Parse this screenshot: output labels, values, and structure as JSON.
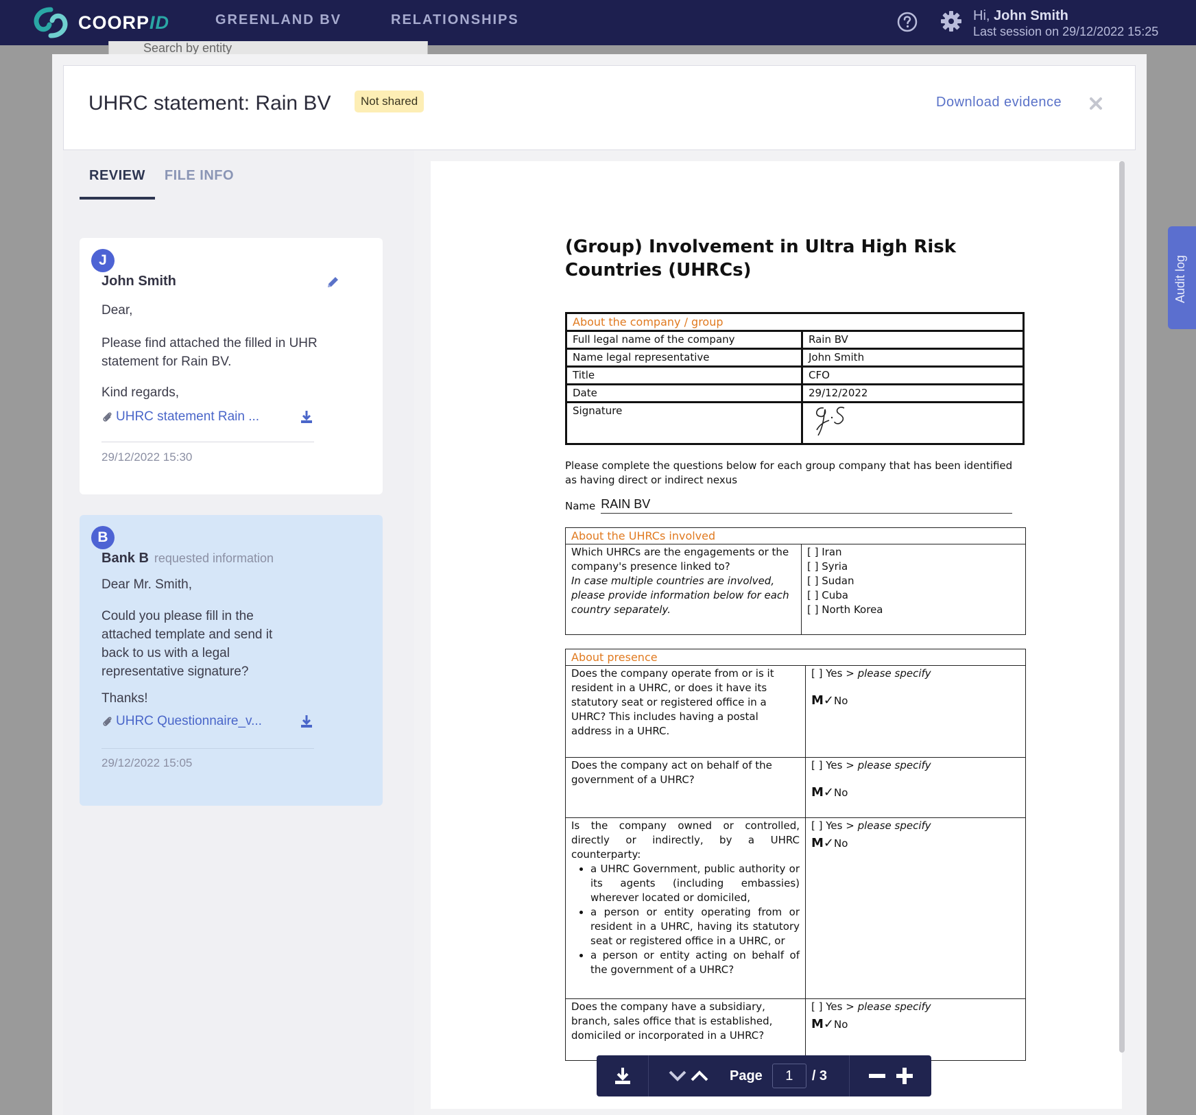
{
  "topbar": {
    "logo_text": "COORP",
    "logo_suffix": "ID",
    "nav": [
      "GREENLAND BV",
      "RELATIONSHIPS"
    ],
    "greeting_prefix": "Hi,",
    "user_name": "John Smith",
    "session_text": "Last session on  29/12/2022 15:25"
  },
  "background": {
    "search_placeholder": "Search by entity"
  },
  "modal": {
    "title": "UHRC statement: Rain BV",
    "status": "Not shared",
    "download_label": "Download evidence"
  },
  "tabs": [
    {
      "label": "REVIEW",
      "active": true
    },
    {
      "label": "FILE INFO",
      "active": false
    }
  ],
  "messages": [
    {
      "initial": "J",
      "author": "John Smith",
      "action": "",
      "paragraphs": [
        "Dear,",
        "Please find attached the filled in UHR statement for Rain BV.",
        "Kind regards,"
      ],
      "attachment": "UHRC statement Rain ...",
      "time": "29/12/2022 15:30"
    },
    {
      "initial": "B",
      "author": "Bank B",
      "action": "requested information",
      "paragraphs": [
        "Dear Mr. Smith,",
        "Could you please fill in the attached template and send it back to us with a legal representative signature?",
        "Thanks!"
      ],
      "attachment": "UHRC Questionnaire_v...",
      "time": "29/12/2022 15:05"
    }
  ],
  "document": {
    "title": "(Group) Involvement in Ultra High Risk Countries (UHRCs)",
    "company_section": {
      "heading": "About the company / group",
      "rows": [
        {
          "label": "Full legal name of the company",
          "value": "Rain BV"
        },
        {
          "label": "Name legal representative",
          "value": "John Smith"
        },
        {
          "label": "Title",
          "value": "CFO"
        },
        {
          "label": "Date",
          "value": "29/12/2022"
        },
        {
          "label": "Signature",
          "value": ""
        }
      ]
    },
    "instructions": "Please complete the questions below for each group company that has been identified as having direct or indirect nexus",
    "name_label": "Name",
    "name_value": "RAIN BV",
    "uhrc_section": {
      "heading": "About the UHRCs involved",
      "question": "Which UHRCs are the engagements or the company's presence linked to?",
      "note": "In case multiple countries are involved, please provide information below for each country separately.",
      "options": [
        "[ ] Iran",
        "[ ] Syria",
        "[ ] Sudan",
        "[ ] Cuba",
        "[ ] North Korea"
      ]
    },
    "presence_section": {
      "heading": "About presence",
      "yes_text": "[ ] Yes",
      "specify_text": "> please specify",
      "no_text": "No",
      "questions": [
        {
          "text": "Does the company operate from or is it resident in a UHRC, or does it have its statutory seat or registered office in a UHRC? This includes having a postal address in a UHRC.",
          "bullets": []
        },
        {
          "text": "Does the company act on behalf of the government of a UHRC?",
          "bullets": []
        },
        {
          "text": "Is the company owned or controlled, directly or indirectly, by a UHRC counterparty:",
          "bullets": [
            "a UHRC Government, public authority or its agents (including embassies) wherever located or domiciled,",
            "a person or entity operating from or resident in a UHRC, having its statutory seat or registered office in a UHRC, or",
            "a person or entity acting on behalf of the government of a UHRC?"
          ]
        },
        {
          "text": "Does the company have a subsidiary, branch, sales office that is established, domiciled or incorporated in a UHRC?",
          "bullets": []
        }
      ]
    }
  },
  "toolbar": {
    "page_label": "Page",
    "current_page": "1",
    "total_pages": "/ 3"
  },
  "audit_log_label": "Audit log",
  "colors": {
    "nav_bg": "#1d1f4f",
    "accent": "#4d63d4",
    "badge_bg": "#fdeeb5",
    "section_orange": "#e07a20",
    "link": "#5a72c8"
  }
}
